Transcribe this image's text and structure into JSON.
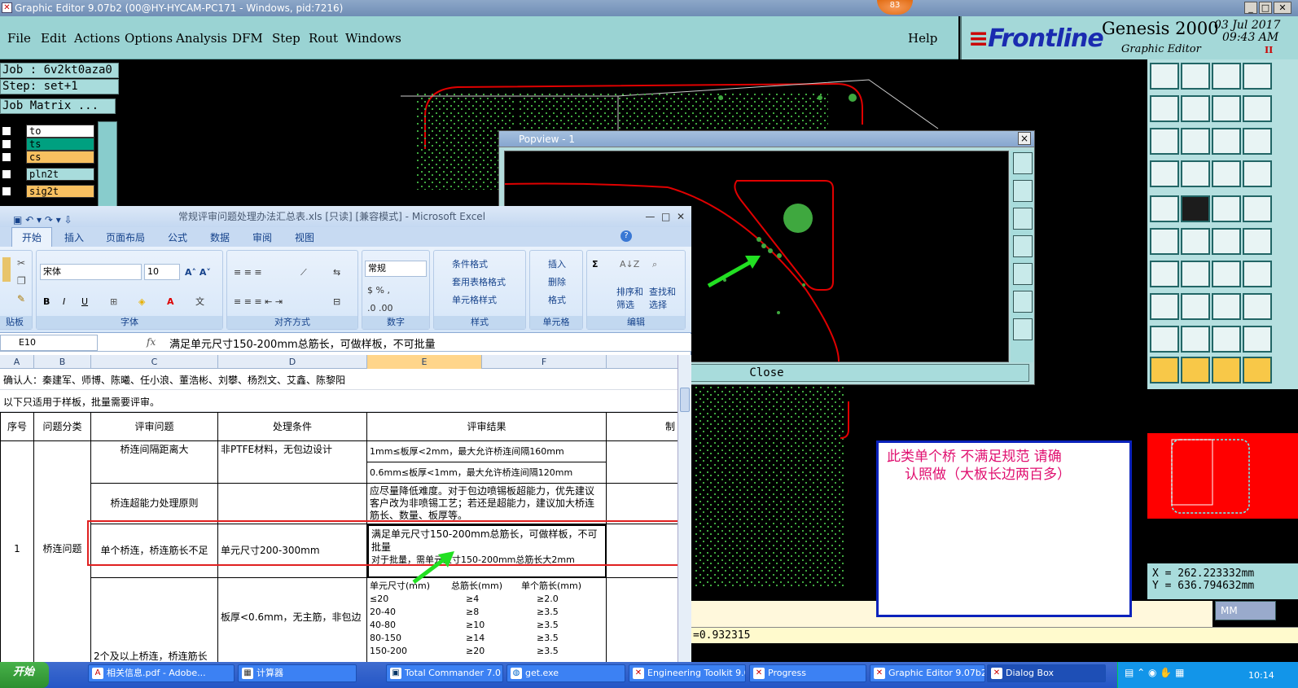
{
  "window": {
    "title": "Graphic Editor 9.07b2 (00@HY-HYCAM-PC171 - Windows, pid:7216)",
    "badge": "83"
  },
  "menu": [
    "File",
    "Edit",
    "Actions",
    "Options",
    "Analysis",
    "DFM",
    "Step",
    "Rout",
    "Windows"
  ],
  "help": "Help",
  "brand": {
    "logo": "Frontline",
    "product": "Genesis 2000",
    "subtitle": "Graphic Editor",
    "date": "03 Jul 2017",
    "time": "09:43 AM",
    "flag": "II"
  },
  "job_panel": {
    "job": "Job : 6v2kt0aza0",
    "step": "Step: set+1",
    "matrix": "Job Matrix ...",
    "layers": [
      {
        "name": "to",
        "color": "#ffffff"
      },
      {
        "name": "ts",
        "color": "#00a080"
      },
      {
        "name": "cs",
        "color": "#f8c060"
      },
      {
        "name": "pln2t",
        "color": "#a8dcdc"
      },
      {
        "name": "sig2t",
        "color": "#f8c060"
      }
    ]
  },
  "popview": {
    "title": "Popview - 1",
    "close_label": "Close",
    "close_x": "×"
  },
  "coords": {
    "x": "X = 262.223332mm",
    "y": "Y = 636.794632mm"
  },
  "units": "MM",
  "status": "=0.932315",
  "note": {
    "line1": "此类单个桥   不满足规范   请确",
    "line2": "认照做（大板长边两百多）"
  },
  "excel": {
    "title": "常规评审问题处理办法汇总表.xls  [只读]  [兼容模式] - Microsoft Excel",
    "tabs": [
      "开始",
      "插入",
      "页面布局",
      "公式",
      "数据",
      "审阅",
      "视图"
    ],
    "font_name": "宋体",
    "font_size": "10",
    "number_format": "常规",
    "groups": [
      "贴板",
      "字体",
      "对齐方式",
      "数字",
      "样式",
      "单元格",
      "编辑"
    ],
    "style_items": [
      "条件格式",
      "套用表格格式",
      "单元格样式"
    ],
    "cell_items": [
      "插入",
      "删除",
      "格式"
    ],
    "edit_items": [
      "排序和",
      "筛选",
      "查找和",
      "选择"
    ],
    "name_box": "E10",
    "fx": "fx",
    "formula": "满足单元尺寸150-200mm总筋长，可做样板，不可批量",
    "columns": [
      "A",
      "B",
      "C",
      "D",
      "E",
      "F"
    ],
    "row1": "确认人：秦建军、师博、陈曦、任小浪、董浩彬、刘攀、杨烈文、艾鑫、陈黎阳",
    "row2": "以下只适用于样板，批量需要评审。",
    "headers": [
      "序号",
      "问题分类",
      "评审问题",
      "处理条件",
      "评审结果",
      "制"
    ],
    "seq": "1",
    "category": "桥连问题",
    "issue1": "桥连间隔距离大",
    "cond1": "非PTFE材料，无包边设计",
    "res1a": "1mm≤板厚<2mm，最大允许桥连间隔160mm",
    "res1b": "0.6mm≤板厚<1mm，最大允许桥连间隔120mm",
    "issue2": "桥连超能力处理原则",
    "res2": "应尽量降低难度。对于包边喷锡板超能力，优先建议客户改为非喷锡工艺；若还是超能力，建议加大桥连筋长、数量、板厚等。",
    "issue3": "单个桥连，桥连筋长不足",
    "cond3": "单元尺寸200-300mm",
    "res3a": "满足单元尺寸150-200mm总筋长，可做样板，不可批量",
    "res3b": "对于批量，需单元尺寸150-200mm总筋长大2mm",
    "issue4": "2个及以上桥连，桥连筋长",
    "cond4": "板厚<0.6mm，无主筋，非包边",
    "table_head": [
      "单元尺寸(mm)",
      "总筋长(mm)",
      "单个筋长(mm)"
    ],
    "table_rows": [
      [
        "≤20",
        "≥4",
        "≥2.0"
      ],
      [
        "20-40",
        "≥8",
        "≥3.5"
      ],
      [
        "40-80",
        "≥10",
        "≥3.5"
      ],
      [
        "80-150",
        "≥14",
        "≥3.5"
      ],
      [
        "150-200",
        "≥20",
        "≥3.5"
      ]
    ]
  },
  "taskbar": {
    "start": "开始",
    "items": [
      {
        "label": "相关信息.pdf - Adobe..."
      },
      {
        "label": "计算器"
      },
      {
        "label": "Total Commander 7.0 ..."
      },
      {
        "label": "get.exe"
      },
      {
        "label": "Engineering Toolkit 9.0..."
      },
      {
        "label": "Progress"
      },
      {
        "label": "Graphic Editor 9.07b2 ..."
      },
      {
        "label": "Dialog Box"
      }
    ],
    "clock": "10:14"
  }
}
